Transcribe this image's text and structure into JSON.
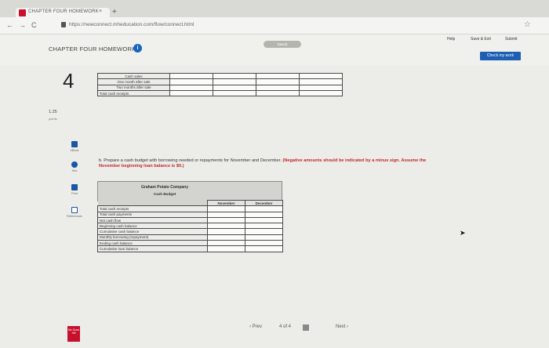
{
  "browser": {
    "tab_title": "CHAPTER FOUR HOMEWORK",
    "tab_close": "×",
    "new_tab": "+",
    "back": "←",
    "forward": "→",
    "reload": "C",
    "url": "https://newconnect.mheducation.com/flow/connect.html",
    "star": "☆"
  },
  "header": {
    "title": "CHAPTER FOUR HOMEWORK",
    "info": "i",
    "saved": "Saved",
    "help": "Help",
    "save_exit": "Save & Exit",
    "submit": "Submit",
    "check_work": "Check my work"
  },
  "question": {
    "number": "4",
    "points_value": "1.25",
    "points_label": "points"
  },
  "tools": [
    {
      "label": "eBook",
      "color": "#1a56a6"
    },
    {
      "label": "Hint",
      "color": "#1a56a6"
    },
    {
      "label": "Print",
      "color": "#1a56a6"
    },
    {
      "label": "References",
      "color": "#1a56a6"
    }
  ],
  "receipts_table": {
    "rows": [
      "Cash sales",
      "One month after sale",
      "Two months after sale",
      "Total cash receipts"
    ]
  },
  "instruction": {
    "part": "b. Prepare a cash budget with borrowing needed or repayments for November and December.",
    "red_note": "(Negative amounts should be indicated by a minus sign.",
    "bold_note": "Assume the November beginning loan balance is $0.)"
  },
  "cash_budget": {
    "company": "Graham Potato Company",
    "subtitle": "Cash Budget",
    "columns": [
      "November",
      "December"
    ],
    "rows": [
      "Total cash receipts",
      "Total cash payments",
      "Net cash flow",
      "Beginning cash balance",
      "Cumulative cash balance",
      "Monthly borrowing (repayment)",
      "Ending cash balance",
      "Cumulative loan balance"
    ]
  },
  "pager": {
    "prev": "‹ Prev",
    "position": "4 of 4",
    "next": "Next ›"
  },
  "brand": "Mc Graw Hill"
}
